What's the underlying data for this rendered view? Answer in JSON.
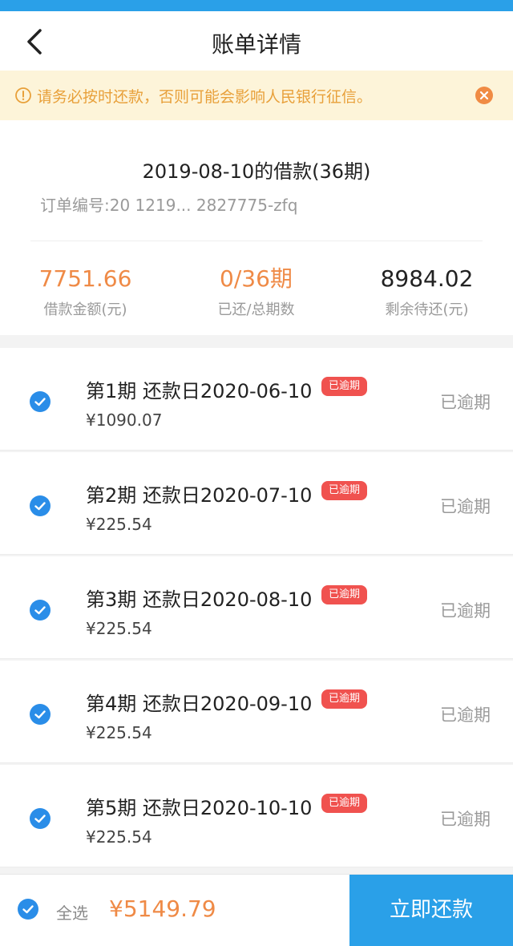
{
  "nav": {
    "title": "账单详情"
  },
  "notice": {
    "text": "请务必按时还款，否则可能会影响人民银行征信。"
  },
  "summary": {
    "loan_title": "2019-08-10的借款(36期)",
    "order_no": "订单编号:20      1219...           2827775-zfq",
    "stats": [
      {
        "value": "7751.66",
        "label": "借款金额(元)"
      },
      {
        "value": "0/36期",
        "label": "已还/总期数"
      },
      {
        "value": "8984.02",
        "label": "剩余待还(元)"
      }
    ]
  },
  "installments": [
    {
      "title": "第1期 还款日2020-06-10",
      "badge": "已逾期",
      "amount": "¥1090.07",
      "status": "已逾期"
    },
    {
      "title": "第2期 还款日2020-07-10",
      "badge": "已逾期",
      "amount": "¥225.54",
      "status": "已逾期"
    },
    {
      "title": "第3期 还款日2020-08-10",
      "badge": "已逾期",
      "amount": "¥225.54",
      "status": "已逾期"
    },
    {
      "title": "第4期 还款日2020-09-10",
      "badge": "已逾期",
      "amount": "¥225.54",
      "status": "已逾期"
    },
    {
      "title": "第5期 还款日2020-10-10",
      "badge": "已逾期",
      "amount": "¥225.54",
      "status": "已逾期"
    }
  ],
  "bottom": {
    "select_all_label": "全选",
    "total": "¥5149.79",
    "pay_button": "立即还款"
  },
  "colors": {
    "accent_blue": "#2aa0e8",
    "check_blue": "#2a8de8",
    "orange": "#ef8a46",
    "overdue_red": "#f0524f",
    "notice_bg": "#fdf4d9"
  },
  "icons": {
    "back": "chevron-left-icon",
    "notice": "info-icon",
    "close": "close-icon",
    "check": "checkmark-icon"
  }
}
